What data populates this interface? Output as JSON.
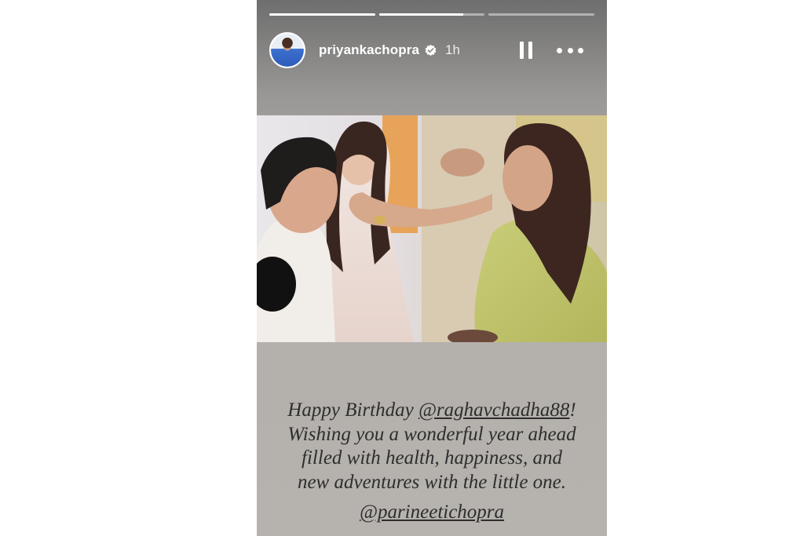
{
  "story": {
    "progress": [
      1.0,
      0.8,
      0.0
    ],
    "header": {
      "username": "priyankachopra",
      "verified_icon": "verified-badge-icon",
      "time": "1h",
      "pause_icon": "pause-icon",
      "more_icon": "more-options-icon"
    },
    "caption": {
      "line1_prefix": "Happy Birthday ",
      "line1_mention": "@raghavchadha88",
      "line1_suffix": "!",
      "line2": "Wishing you a wonderful year ahead",
      "line3": "filled with health, happiness, and",
      "line4": "new adventures with the little one."
    },
    "tag": "@parineetichopra"
  }
}
